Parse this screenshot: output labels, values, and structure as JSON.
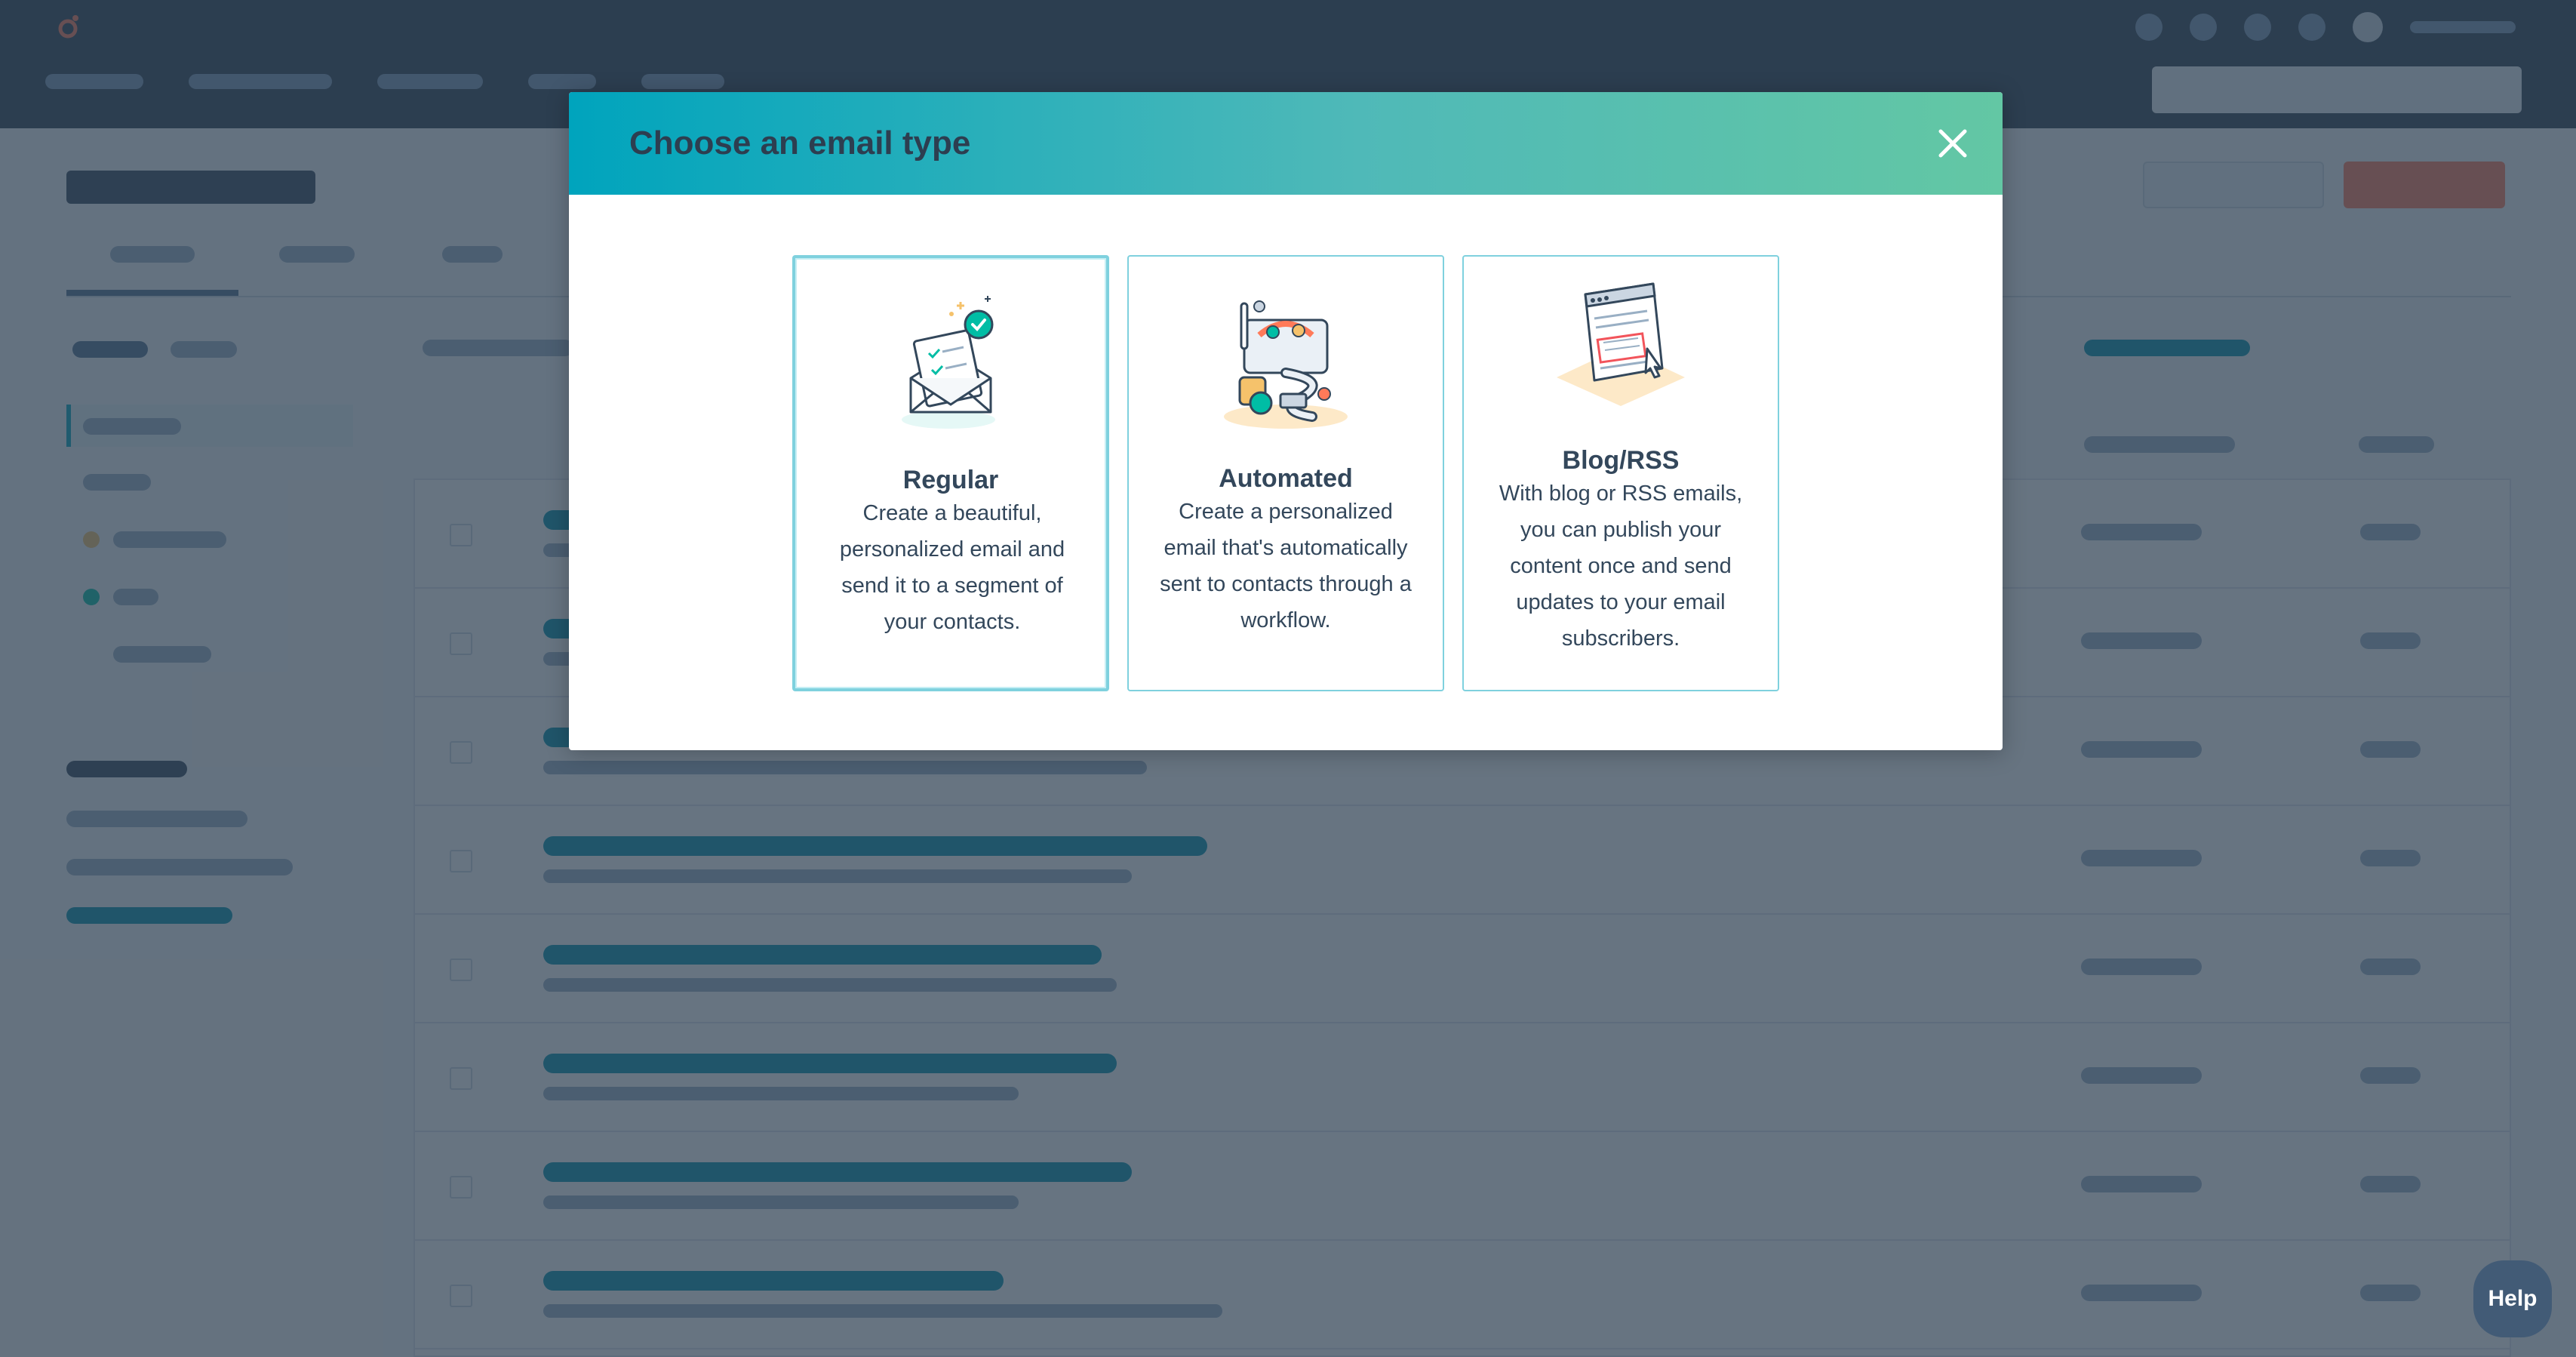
{
  "modal": {
    "title": "Choose an email type",
    "cards": [
      {
        "title": "Regular",
        "description": "Create a beautiful, personalized email and send it to a segment of your contacts.",
        "icon": "envelope-checklist-icon",
        "selected": true
      },
      {
        "title": "Automated",
        "description": "Create a personalized email that's automatically sent to contacts through a workflow.",
        "icon": "automation-machine-icon",
        "selected": false
      },
      {
        "title": "Blog/RSS",
        "description": "With blog or RSS emails, you can publish your content once and send updates to your email subscribers.",
        "icon": "blog-browser-icon",
        "selected": false
      }
    ]
  },
  "help": {
    "label": "Help"
  },
  "colors": {
    "header_gradient_start": "#00a4bd",
    "header_gradient_end": "#63c7a4",
    "card_border": "#7fd1de",
    "overlay": "#2d3e50",
    "help_button": "#425b76"
  }
}
